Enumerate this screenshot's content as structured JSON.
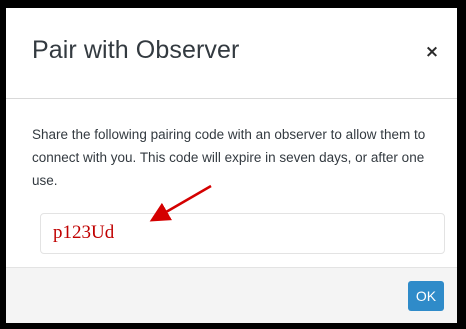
{
  "modal": {
    "title": "Pair with Observer",
    "close_label": "×",
    "description": "Share the following pairing code with an observer to allow them to connect with you. This code will expire in seven days, or after one use.",
    "pairing_code": "p123Ud",
    "ok_label": "OK"
  },
  "colors": {
    "annotation_arrow": "#d40000",
    "code_text": "#c00000",
    "ok_button": "#2f8bc9"
  }
}
